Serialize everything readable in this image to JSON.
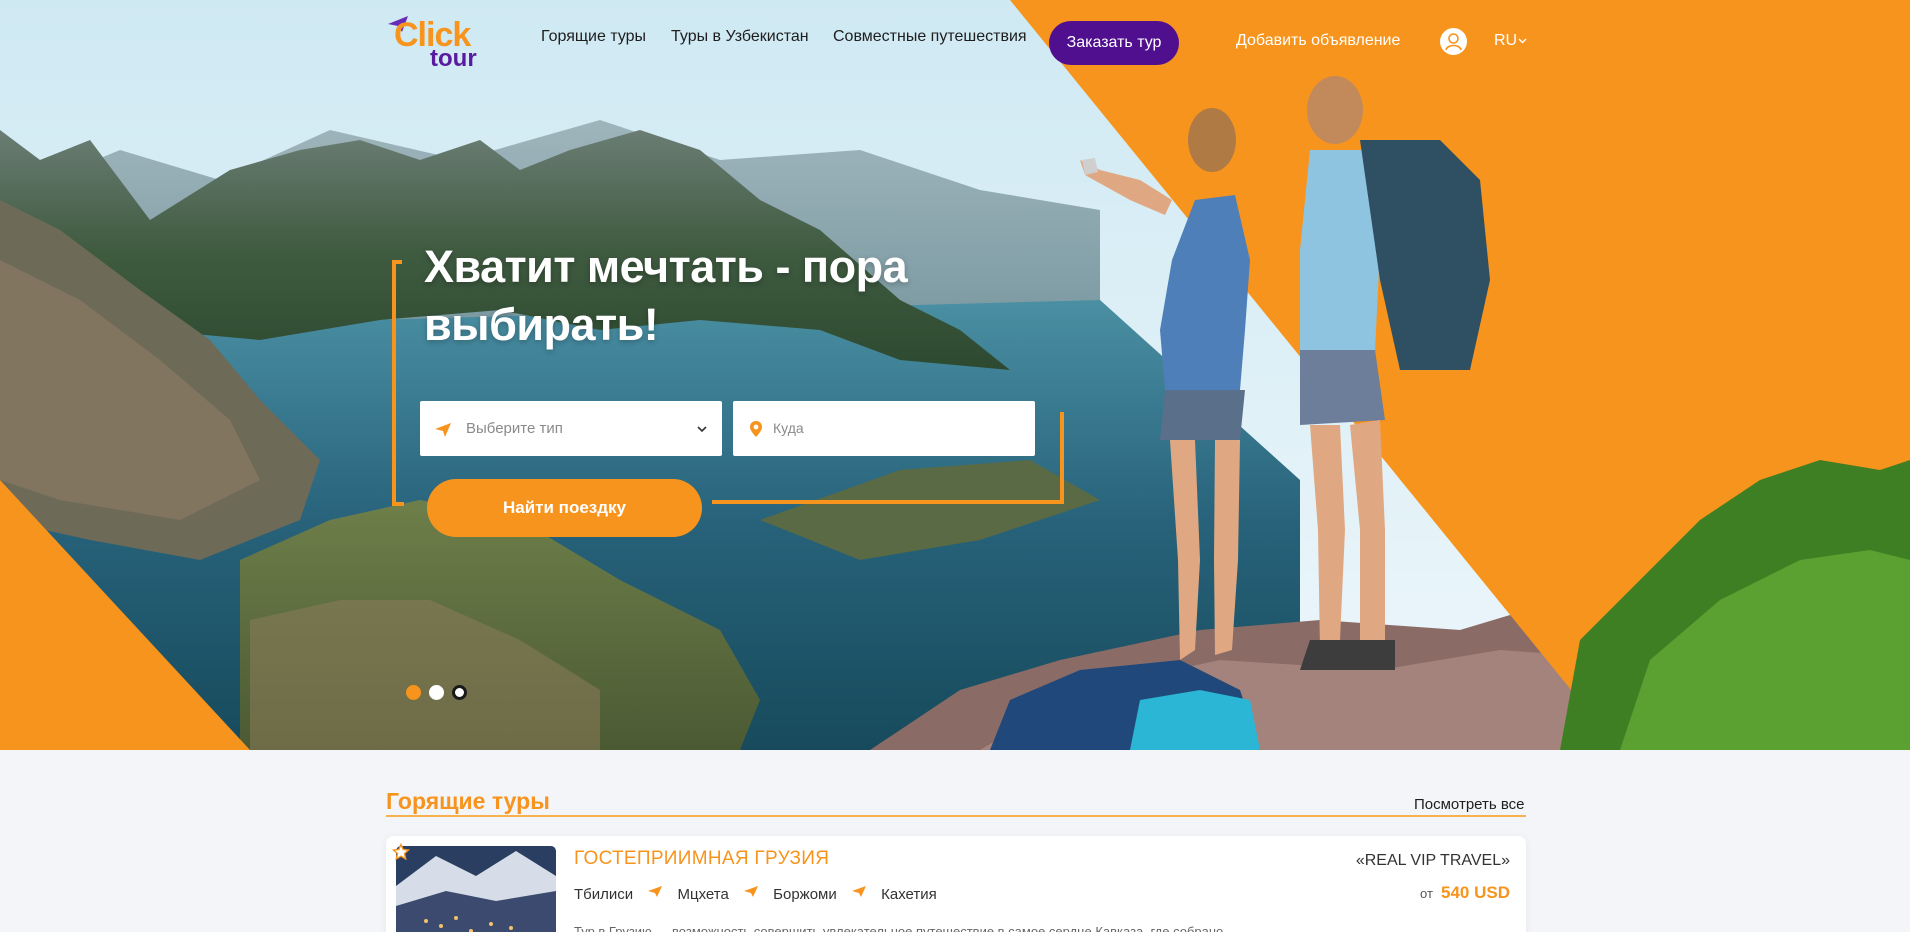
{
  "header": {
    "logo_text_1": "Click",
    "logo_text_2": "tour",
    "nav": [
      "Горящие туры",
      "Туры в Узбекистан",
      "Совместные путешествия"
    ],
    "order_button": "Заказать тур",
    "add_ad": "Добавить объявление",
    "language": "RU"
  },
  "hero": {
    "title": "Хватит мечтать - пора выбирать!",
    "type_placeholder": "Выберите тип",
    "destination_placeholder": "Куда",
    "search_button": "Найти поездку",
    "slides_count": 3,
    "active_slide": 1
  },
  "hot_tours": {
    "title": "Горящие туры",
    "see_all": "Посмотреть все",
    "tours": [
      {
        "name": "ГОСТЕПРИИМНАЯ ГРУЗИЯ",
        "route": [
          "Тбилиси",
          "Мцхета",
          "Боржоми",
          "Кахетия"
        ],
        "agency": "«REAL VIP TRAVEL»",
        "price_prefix": "от",
        "price": "540 USD",
        "description": "Тур в Грузию — возможность совершить увлекательное путешествие в самое сердце Кавказа, где собрано"
      }
    ]
  },
  "colors": {
    "accent": "#f7941d",
    "brand_purple": "#4f0f8f"
  }
}
